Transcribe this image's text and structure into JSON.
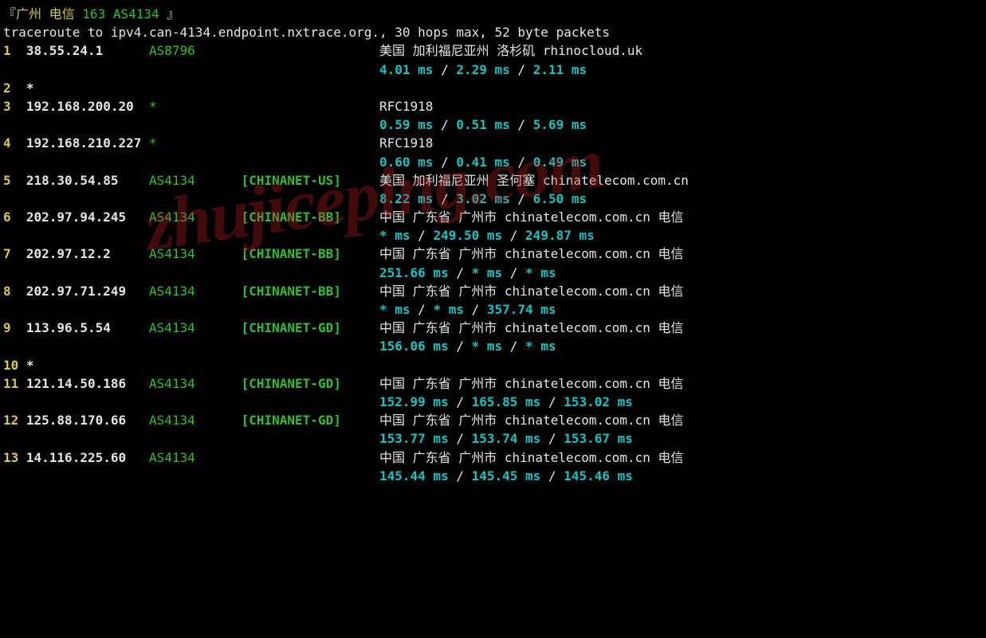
{
  "header": {
    "open": "『",
    "loc": "广州 电信 ",
    "asn": "163 AS4134 ",
    "close": "』"
  },
  "command": "traceroute to ipv4.can-4134.endpoint.nxtrace.org., 30 hops max, 52 byte packets",
  "hops": [
    {
      "idx": "1",
      "ip": "38.55.24.1",
      "asn": "AS8796",
      "net": "",
      "loc": "美国 加利福尼亚州 洛杉矶  rhinocloud.uk",
      "t": [
        "4.01 ms",
        "2.29 ms",
        "2.11 ms"
      ]
    },
    {
      "idx": "2",
      "ip": "*",
      "asn": "",
      "net": "",
      "loc": "",
      "t": null
    },
    {
      "idx": "3",
      "ip": "192.168.200.20",
      "asn": "*",
      "net": "",
      "loc": "RFC1918",
      "t": [
        "0.59 ms",
        "0.51 ms",
        "5.69 ms"
      ]
    },
    {
      "idx": "4",
      "ip": "192.168.210.227",
      "asn": "*",
      "net": "",
      "loc": "RFC1918",
      "t": [
        "0.60 ms",
        "0.41 ms",
        "0.49 ms"
      ]
    },
    {
      "idx": "5",
      "ip": "218.30.54.85",
      "asn": "AS4134",
      "net": "[CHINANET-US]",
      "loc": "美国 加利福尼亚州 圣何塞  chinatelecom.com.cn",
      "t": [
        "8.22 ms",
        "3.02 ms",
        "6.50 ms"
      ]
    },
    {
      "idx": "6",
      "ip": "202.97.94.245",
      "asn": "AS4134",
      "net": "[CHINANET-BB]",
      "loc": "中国 广东省 广州市  chinatelecom.com.cn  电信",
      "t": [
        "* ms",
        "249.50 ms",
        "249.87 ms"
      ]
    },
    {
      "idx": "7",
      "ip": "202.97.12.2",
      "asn": "AS4134",
      "net": "[CHINANET-BB]",
      "loc": "中国 广东省 广州市  chinatelecom.com.cn  电信",
      "t": [
        "251.66 ms",
        "* ms",
        "* ms"
      ]
    },
    {
      "idx": "8",
      "ip": "202.97.71.249",
      "asn": "AS4134",
      "net": "[CHINANET-BB]",
      "loc": "中国 广东省 广州市  chinatelecom.com.cn  电信",
      "t": [
        "* ms",
        "* ms",
        "357.74 ms"
      ]
    },
    {
      "idx": "9",
      "ip": "113.96.5.54",
      "asn": "AS4134",
      "net": "[CHINANET-GD]",
      "loc": "中国 广东省 广州市  chinatelecom.com.cn  电信",
      "t": [
        "156.06 ms",
        "* ms",
        "* ms"
      ]
    },
    {
      "idx": "10",
      "ip": "*",
      "asn": "",
      "net": "",
      "loc": "",
      "t": null
    },
    {
      "idx": "11",
      "ip": "121.14.50.186",
      "asn": "AS4134",
      "net": "[CHINANET-GD]",
      "loc": "中国 广东省 广州市  chinatelecom.com.cn  电信",
      "t": [
        "152.99 ms",
        "165.85 ms",
        "153.02 ms"
      ]
    },
    {
      "idx": "12",
      "ip": "125.88.170.66",
      "asn": "AS4134",
      "net": "[CHINANET-GD]",
      "loc": "中国 广东省 广州市  chinatelecom.com.cn  电信",
      "t": [
        "153.77 ms",
        "153.74 ms",
        "153.67 ms"
      ]
    },
    {
      "idx": "13",
      "ip": "14.116.225.60",
      "asn": "AS4134",
      "net": "",
      "loc": "中国 广东省 广州市  chinatelecom.com.cn  电信",
      "t": [
        "145.44 ms",
        "145.45 ms",
        "145.46 ms"
      ]
    }
  ],
  "watermark": "zhujiceping.com"
}
